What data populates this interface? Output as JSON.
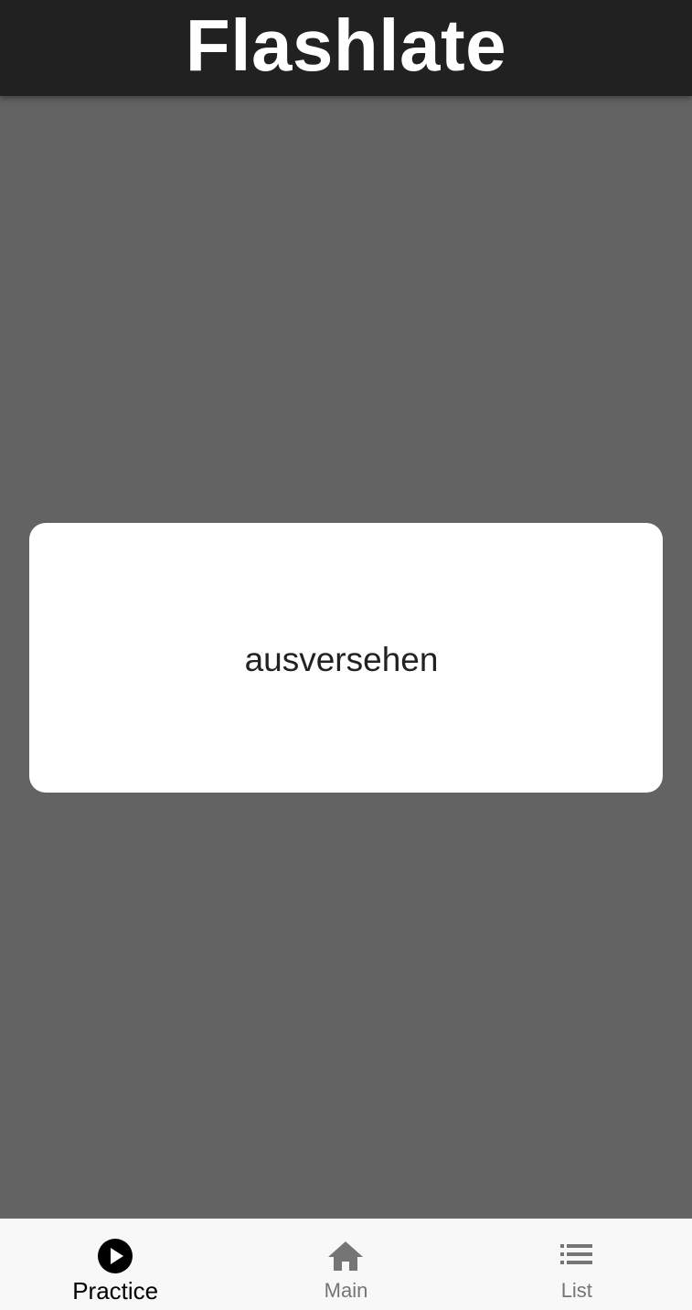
{
  "app": {
    "title": "Flashlate"
  },
  "flashcard": {
    "word": "ausversehen"
  },
  "bottom_nav": {
    "items": [
      {
        "label": "Practice",
        "icon": "play-circle-icon",
        "active": true
      },
      {
        "label": "Main",
        "icon": "home-icon",
        "active": false
      },
      {
        "label": "List",
        "icon": "list-icon",
        "active": false
      }
    ]
  },
  "colors": {
    "app_bar": "#212121",
    "background": "#636363",
    "card": "#ffffff",
    "nav_background": "#f8f8f8",
    "nav_active": "#000000",
    "nav_inactive": "#757575"
  }
}
